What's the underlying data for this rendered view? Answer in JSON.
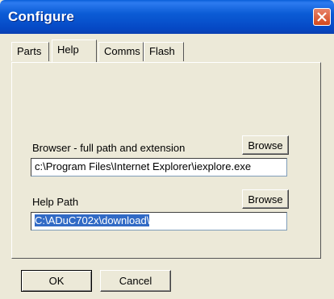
{
  "window": {
    "title": "Configure"
  },
  "tabs": [
    {
      "label": "Parts"
    },
    {
      "label": "Help"
    },
    {
      "label": "Comms"
    },
    {
      "label": "Flash"
    }
  ],
  "active_tab": "Help",
  "browser": {
    "label": "Browser - full path and extension",
    "value": "c:\\Program Files\\Internet Explorer\\iexplore.exe",
    "browse_label": "Browse"
  },
  "help_path": {
    "label": "Help Path",
    "value": "C:\\ADuC702x\\download\\",
    "browse_label": "Browse"
  },
  "buttons": {
    "ok": "OK",
    "cancel": "Cancel"
  },
  "colors": {
    "titlebar": "#0b5cd6",
    "selection": "#316ac5",
    "close": "#d2481d"
  }
}
